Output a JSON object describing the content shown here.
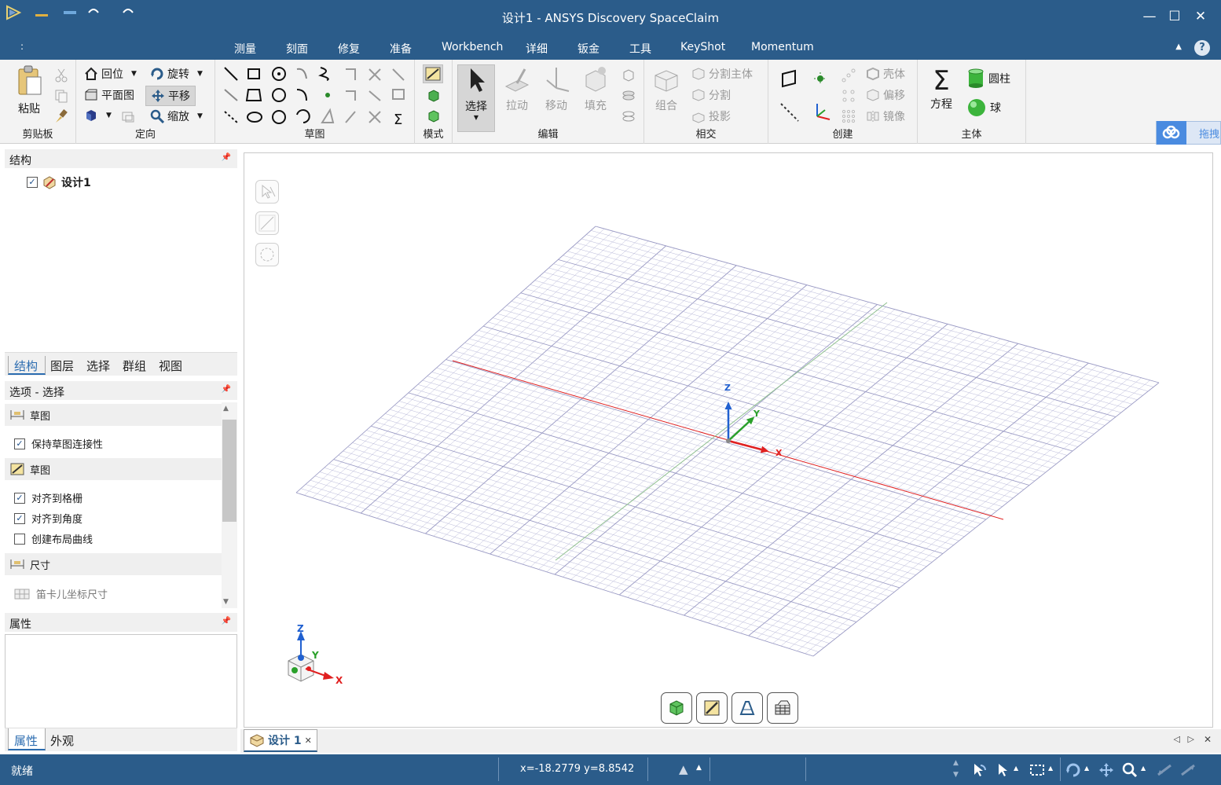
{
  "window": {
    "title": "设计1 - ANSYS Discovery SpaceClaim",
    "minimize": "—",
    "maximize": "☐",
    "close": "✕"
  },
  "tabs": [
    "测量",
    "刻面",
    "修复",
    "准备",
    "Workbench",
    "详细",
    "钣金",
    "工具",
    "KeyShot",
    "Momentum"
  ],
  "help": "?",
  "ribbon": {
    "clipboard": {
      "label": "剪贴板",
      "paste": "粘贴"
    },
    "orient": {
      "label": "定向",
      "home": "回位",
      "plan_view": "平面图",
      "rotate": "旋转",
      "pan": "平移",
      "zoom": "缩放"
    },
    "sketch": {
      "label": "草图"
    },
    "mode": {
      "label": "模式"
    },
    "edit": {
      "label": "编辑",
      "select": "选择",
      "pull": "拉动",
      "move": "移动",
      "fill": "填充"
    },
    "intersect": {
      "label": "相交",
      "combine": "组合",
      "split_body": "分割主体",
      "split": "分割",
      "project": "投影"
    },
    "create": {
      "label": "创建",
      "shell": "壳体",
      "offset": "偏移",
      "mirror": "镜像"
    },
    "body": {
      "label": "主体",
      "equation": "方程",
      "cylinder": "圆柱",
      "sphere": "球"
    }
  },
  "side_badge": "拖拽",
  "structure_panel": {
    "title": "结构",
    "tree_root": "设计1",
    "tabs": [
      "结构",
      "图层",
      "选择",
      "群组",
      "视图"
    ]
  },
  "options_panel": {
    "title": "选项 - 选择",
    "sections": [
      {
        "label": "草图",
        "items": [
          {
            "label": "保持草图连接性",
            "checked": true
          }
        ]
      },
      {
        "label": "草图",
        "items": [
          {
            "label": "对齐到格栅",
            "checked": true
          },
          {
            "label": "对齐到角度",
            "checked": true
          },
          {
            "label": "创建布局曲线",
            "checked": false
          }
        ]
      },
      {
        "label": "尺寸",
        "items": [
          {
            "label": "笛卡儿坐标尺寸",
            "checked": false
          }
        ]
      }
    ]
  },
  "properties_panel": {
    "title": "属性",
    "tabs": [
      "属性",
      "外观"
    ]
  },
  "viewport": {
    "axis_x": "X",
    "axis_y": "Y",
    "axis_z": "Z"
  },
  "doc_tab": {
    "label": "设计 1",
    "close": "✕"
  },
  "status": {
    "text": "就绪",
    "coords": "x=-18.2779  y=8.8542"
  },
  "colors": {
    "chrome": "#2b5c8a",
    "x_axis": "#e02020",
    "y_axis": "#2aa02a",
    "z_axis": "#2060d0",
    "grid": "#b8b8d8"
  }
}
